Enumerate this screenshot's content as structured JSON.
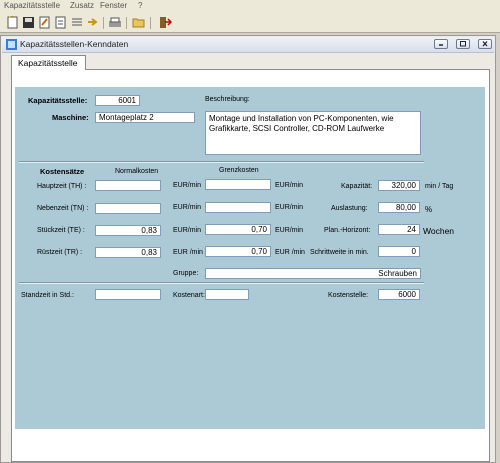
{
  "menu": [
    "Kapazitätsstelle",
    "Zusatz",
    "Fenster",
    "?"
  ],
  "window": {
    "title": "Kapazitätsstellen-Kenndaten"
  },
  "tab": {
    "label": "Kapazitätsstelle"
  },
  "form": {
    "kapazitaetsstelle": {
      "label": "Kapazitätsstelle:",
      "value": "6001"
    },
    "maschine": {
      "label": "Maschine:",
      "value": "Montageplatz 2"
    },
    "beschreibung": {
      "label": "Beschreibung:",
      "value": "Montage und Installation von PC-Komponenten, wie Grafikkarte, SCSI Controller, CD-ROM Laufwerke"
    },
    "kostensaetze": {
      "title": "Kostensätze",
      "normal_header": "Normalkosten",
      "grenz_header": "Grenzkosten",
      "rows": [
        {
          "label": "Hauptzeit (TH) :",
          "normal": "",
          "normal_unit": "EUR/min",
          "grenz": "",
          "grenz_unit": "EUR/min"
        },
        {
          "label": "Nebenzeit (TN) :",
          "normal": "",
          "normal_unit": "EUR/min",
          "grenz": "",
          "grenz_unit": "EUR/min"
        },
        {
          "label": "Stückzeit (TE) :",
          "normal": "0,83",
          "normal_unit": "EUR/min",
          "grenz": "0,70",
          "grenz_unit": "EUR/min"
        },
        {
          "label": "Rüstzeit (TR) :",
          "normal": "0,83",
          "normal_unit": "EUR /min",
          "grenz": "0,70",
          "grenz_unit": "EUR /min"
        }
      ]
    },
    "kapazitaet": {
      "label": "Kapazität:",
      "value": "320,00",
      "unit": "min / Tag"
    },
    "auslastung": {
      "label": "Auslastung:",
      "value": "80,00",
      "unit": "%"
    },
    "plan_horizont": {
      "label": "Plan.-Horizont:",
      "value": "24",
      "unit": "Wochen"
    },
    "schrittweite": {
      "label": "Schrittweite in min.",
      "value": "0"
    },
    "gruppe": {
      "label": "Gruppe:",
      "value": "Schrauben"
    },
    "standzeit": {
      "label": "Standzeit in Std.:",
      "value": ""
    },
    "kostenart": {
      "label": "Kostenart:",
      "value": ""
    },
    "kostenstelle": {
      "label": "Kostenstelle:",
      "value": "6000"
    }
  }
}
